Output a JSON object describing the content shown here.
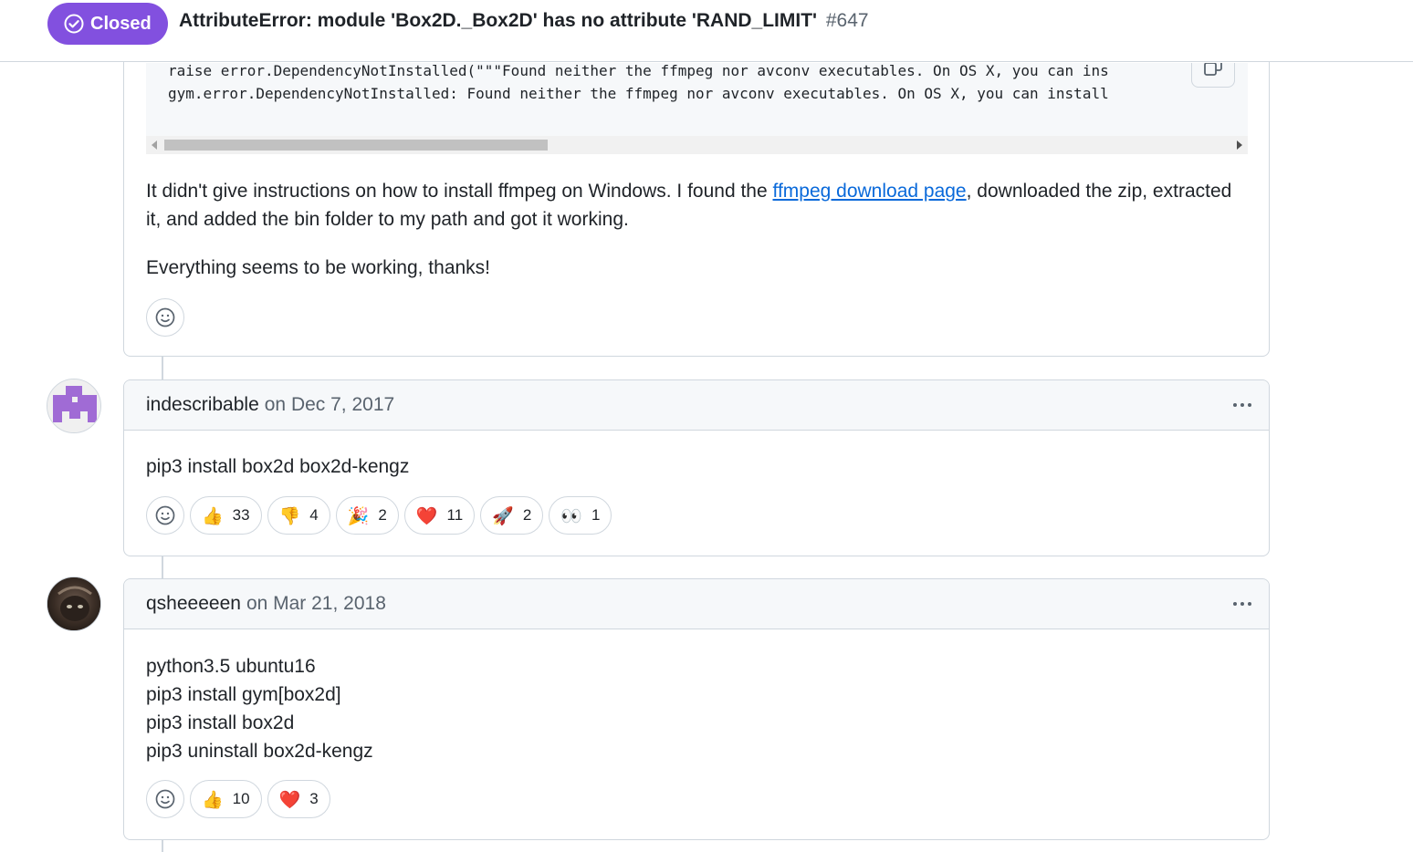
{
  "header": {
    "state": "Closed",
    "title": "AttributeError: module 'Box2D._Box2D' has no attribute 'RAND_LIMIT'",
    "number": "#647"
  },
  "comment0": {
    "code_lines": [
      "raise error.DependencyNotInstalled(\"\"\"Found neither the ffmpeg nor avconv executables. On OS X, you can ins",
      "gym.error.DependencyNotInstalled: Found neither the ffmpeg nor avconv executables. On OS X, you can install"
    ],
    "para1_before": "It didn't give instructions on how to install ffmpeg on Windows. I found the ",
    "para1_link": "ffmpeg download page",
    "para1_after": ", downloaded the zip, extracted it, and added the bin folder to my path and got it working.",
    "para2": "Everything seems to be working, thanks!"
  },
  "comment1": {
    "author": "indescribable",
    "date": "on Dec 7, 2017",
    "body": "pip3 install box2d box2d-kengz",
    "reactions": [
      {
        "emoji": "👍",
        "icon": "thumbs-up",
        "count": "33"
      },
      {
        "emoji": "👎",
        "icon": "thumbs-down",
        "count": "4"
      },
      {
        "emoji": "🎉",
        "icon": "party-popper",
        "count": "2"
      },
      {
        "emoji": "❤️",
        "icon": "heart",
        "count": "11"
      },
      {
        "emoji": "🚀",
        "icon": "rocket",
        "count": "2"
      },
      {
        "emoji": "👀",
        "icon": "eyes",
        "count": "1"
      }
    ]
  },
  "comment2": {
    "author": "qsheeeeen",
    "date": "on Mar 21, 2018",
    "lines": [
      "python3.5 ubuntu16",
      "pip3 install gym[box2d]",
      "pip3 install box2d",
      "pip3 uninstall box2d-kengz"
    ],
    "reactions": [
      {
        "emoji": "👍",
        "icon": "thumbs-up",
        "count": "10"
      },
      {
        "emoji": "❤️",
        "icon": "heart",
        "count": "3"
      }
    ]
  },
  "colors": {
    "closed_purple": "#8250df",
    "link_blue": "#0969da",
    "border": "#d0d7de",
    "header_bg": "#f6f8fa",
    "avatar_identicon": "#a06bd5"
  }
}
